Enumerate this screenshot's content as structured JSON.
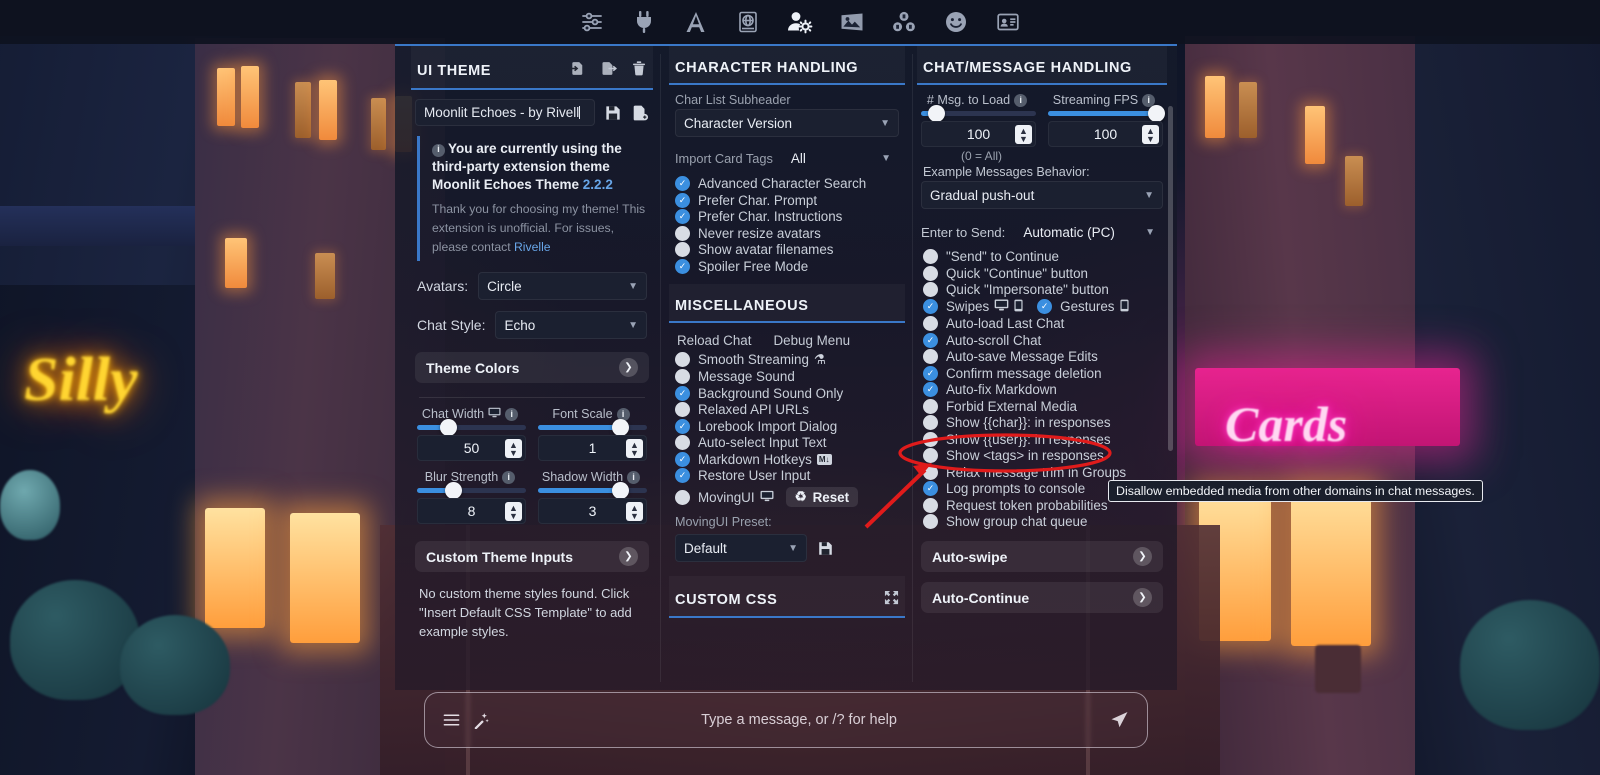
{
  "topbar": {
    "icons": [
      {
        "name": "sliders-icon",
        "label": "AI Response Configuration"
      },
      {
        "name": "plug-icon",
        "label": "API Connections"
      },
      {
        "name": "font-a-icon",
        "label": "Advanced Formatting"
      },
      {
        "name": "worldinfo-icon",
        "label": "World Info"
      },
      {
        "name": "user-settings-icon",
        "label": "User Settings",
        "active": true
      },
      {
        "name": "image-icon",
        "label": "Backgrounds"
      },
      {
        "name": "extensions-icon",
        "label": "Extensions"
      },
      {
        "name": "smiley-icon",
        "label": "Persona Management"
      },
      {
        "name": "character-card-icon",
        "label": "Character Management"
      }
    ]
  },
  "ui_theme": {
    "title": "UI THEME",
    "tools": [
      "import-theme",
      "export-theme",
      "delete-theme"
    ],
    "theme_name": "Moonlit Echoes - by Rivell",
    "save_label": "save-theme",
    "newfile_label": "new-theme",
    "notice_headline": "You are currently using the third-party extension theme Moonlit Echoes Theme",
    "notice_version": "2.2.2",
    "notice_body_1": "Thank you for choosing my theme! This extension is unofficial. For issues, please contact ",
    "notice_author": "Rivelle",
    "avatars_label": "Avatars:",
    "avatars_value": "Circle",
    "chat_style_label": "Chat Style:",
    "chat_style_value": "Echo",
    "theme_colors_label": "Theme Colors",
    "sliders": [
      {
        "label": "Chat Width",
        "value": "50",
        "fill_pct": 28,
        "has_monitor": true,
        "has_info": true
      },
      {
        "label": "Font Scale",
        "value": "1",
        "fill_pct": 75,
        "has_monitor": false,
        "has_info": true
      },
      {
        "label": "Blur Strength",
        "value": "8",
        "fill_pct": 33,
        "has_monitor": false,
        "has_info": true
      },
      {
        "label": "Shadow Width",
        "value": "3",
        "fill_pct": 75,
        "has_monitor": false,
        "has_info": true
      }
    ],
    "custom_theme_inputs_label": "Custom Theme Inputs",
    "custom_theme_note": "No custom theme styles found. Click \"Insert Default CSS Template\" to add example styles."
  },
  "character_handling": {
    "title": "CHARACTER HANDLING",
    "subheader_label": "Char List Subheader",
    "subheader_value": "Character Version",
    "import_tags_label": "Import Card Tags",
    "import_tags_value": "All",
    "checkboxes": [
      {
        "label": "Advanced Character Search",
        "checked": true
      },
      {
        "label": "Prefer Char. Prompt",
        "checked": true
      },
      {
        "label": "Prefer Char. Instructions",
        "checked": true
      },
      {
        "label": "Never resize avatars",
        "checked": false
      },
      {
        "label": "Show avatar filenames",
        "checked": false
      },
      {
        "label": "Spoiler Free Mode",
        "checked": true
      }
    ]
  },
  "miscellaneous": {
    "title": "MISCELLANEOUS",
    "links": [
      "Reload Chat",
      "Debug Menu"
    ],
    "checkboxes": [
      {
        "label": "Smooth Streaming",
        "checked": false,
        "badge": "flask"
      },
      {
        "label": "Message Sound",
        "checked": false
      },
      {
        "label": "Background Sound Only",
        "checked": true
      },
      {
        "label": "Relaxed API URLs",
        "checked": false
      },
      {
        "label": "Lorebook Import Dialog",
        "checked": true
      },
      {
        "label": "Auto-select Input Text",
        "checked": false
      },
      {
        "label": "Markdown Hotkeys",
        "checked": true,
        "badge": "md"
      },
      {
        "label": "Restore User Input",
        "checked": true
      },
      {
        "label": "MovingUI",
        "checked": false,
        "badge": "monitor",
        "button": "Reset"
      }
    ],
    "preset_label": "MovingUI Preset:",
    "preset_value": "Default",
    "preset_save": "save-preset"
  },
  "custom_css": {
    "title": "CUSTOM CSS",
    "expand": "expand-editor"
  },
  "chat_handling": {
    "title": "CHAT/MESSAGE HANDLING",
    "sliders": [
      {
        "label": "# Msg. to Load",
        "value": "100",
        "fill_pct": 10
      },
      {
        "label": "Streaming FPS",
        "value": "100",
        "fill_pct": 96
      }
    ],
    "zero_all_hint": "(0 = All)",
    "example_behavior_label": "Example Messages Behavior:",
    "example_behavior_value": "Gradual push-out",
    "enter_to_send_label": "Enter to Send:",
    "enter_to_send_value": "Automatic (PC)",
    "checkboxes": [
      {
        "label": "\"Send\" to Continue",
        "checked": false
      },
      {
        "label": "Quick \"Continue\" button",
        "checked": false
      },
      {
        "label": "Quick \"Impersonate\" button",
        "checked": false
      },
      {
        "label": "Swipes",
        "checked": true,
        "inline": true
      },
      {
        "label": "Auto-load Last Chat",
        "checked": false
      },
      {
        "label": "Auto-scroll Chat",
        "checked": true
      },
      {
        "label": "Auto-save Message Edits",
        "checked": false
      },
      {
        "label": "Confirm message deletion",
        "checked": true
      },
      {
        "label": "Auto-fix Markdown",
        "checked": true
      },
      {
        "label": "Forbid External Media",
        "checked": false,
        "highlighted": true
      },
      {
        "label": "Show {{char}}: in responses",
        "checked": false
      },
      {
        "label": "Show {{user}}: in responses",
        "checked": false
      },
      {
        "label": "Show <tags> in responses",
        "checked": false
      },
      {
        "label": "Relax message trim in Groups",
        "checked": false
      },
      {
        "label": "Log prompts to console",
        "checked": true
      },
      {
        "label": "Request token probabilities",
        "checked": false
      },
      {
        "label": "Show group chat queue",
        "checked": false
      }
    ],
    "gestures_label": "Gestures",
    "gestures_checked": true,
    "drawers": [
      "Auto-swipe",
      "Auto-Continue"
    ]
  },
  "tooltip": {
    "text": "Disallow embedded media from other domains in chat messages."
  },
  "chatbar": {
    "placeholder": "Type a message, or /? for help",
    "options_icon": "hamburger-icon",
    "wand_icon": "magic-wand-icon",
    "send_icon": "send-icon"
  },
  "background": {
    "neon_left": "Silly",
    "neon_right": "Cards"
  },
  "colors": {
    "accent": "#3a78c8",
    "checked": "#3b8fe0",
    "annotation": "#e01b1b"
  }
}
